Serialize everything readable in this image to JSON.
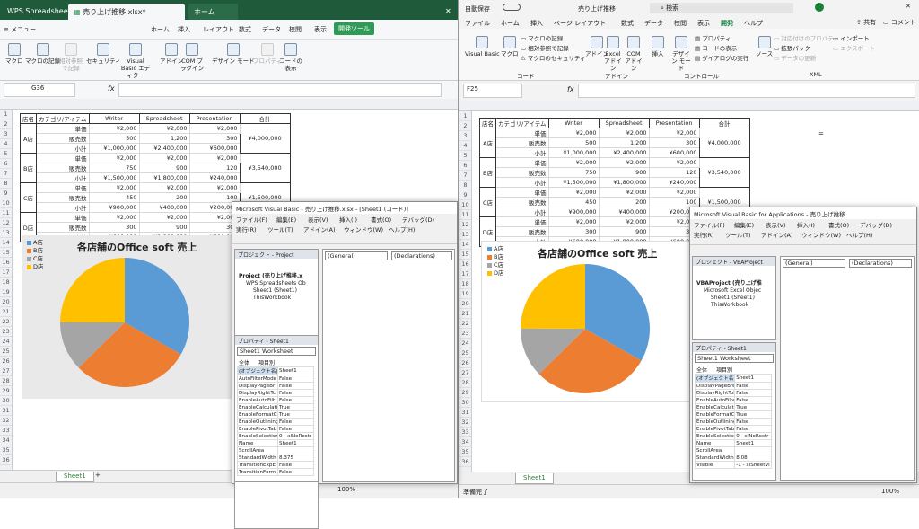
{
  "wps": {
    "tabs": [
      "WPS Spreadsheets",
      "売り上げ推移.xlsx*",
      "ホーム"
    ],
    "menu": [
      "≡ メニュー",
      "ホーム",
      "挿入",
      "レイアウト",
      "数式",
      "データ",
      "校閲",
      "表示",
      "開発ツール"
    ],
    "ribbon": [
      "マクロ",
      "マクロの記録",
      "相対参照で記録",
      "セキュリティ",
      "Visual Basic エディター",
      "アドイン",
      "COM プラグイン",
      "デザイン モード",
      "プロパティ",
      "コードの表示"
    ],
    "cellref": "G36",
    "fx": "fx",
    "cols": [
      "A",
      "B",
      "C",
      "D",
      "E",
      "F",
      "G",
      "H",
      "I"
    ],
    "sheet_tab": "Sheet1",
    "zoom": "100%"
  },
  "table": {
    "header": [
      "店名",
      "カテゴリ/アイテム",
      "Writer",
      "Spreadsheet",
      "Presentation",
      "合計"
    ],
    "stores": [
      {
        "name": "A店",
        "rows": [
          [
            "単価",
            "¥2,000",
            "¥2,000",
            "¥2,000"
          ],
          [
            "販売数",
            "500",
            "1,200",
            "300"
          ],
          [
            "小計",
            "¥1,000,000",
            "¥2,400,000",
            "¥600,000"
          ]
        ],
        "total": "¥4,000,000"
      },
      {
        "name": "B店",
        "rows": [
          [
            "単価",
            "¥2,000",
            "¥2,000",
            "¥2,000"
          ],
          [
            "販売数",
            "750",
            "900",
            "120"
          ],
          [
            "小計",
            "¥1,500,000",
            "¥1,800,000",
            "¥240,000"
          ]
        ],
        "total": "¥3,540,000"
      },
      {
        "name": "C店",
        "rows": [
          [
            "単価",
            "¥2,000",
            "¥2,000",
            "¥2,000"
          ],
          [
            "販売数",
            "450",
            "200",
            "100"
          ],
          [
            "小計",
            "¥900,000",
            "¥400,000",
            "¥200,000"
          ]
        ],
        "total": "¥1,500,000"
      },
      {
        "name": "D店",
        "rows": [
          [
            "単価",
            "¥2,000",
            "¥2,000",
            "¥2,000"
          ],
          [
            "販売数",
            "300",
            "900",
            "300"
          ],
          [
            "小計",
            "¥600,000",
            "¥1,800,000",
            "¥600,000"
          ]
        ],
        "total": ""
      }
    ]
  },
  "chart_data": {
    "type": "pie",
    "title": "各店舗のOffice soft 売上",
    "categories": [
      "A店",
      "B店",
      "C店",
      "D店"
    ],
    "values": [
      4000000,
      3540000,
      1500000,
      3000000
    ],
    "colors": [
      "#5b9bd5",
      "#ed7d31",
      "#a5a5a5",
      "#ffc000"
    ],
    "legend": "top-left"
  },
  "excel": {
    "autosave": "自動保存",
    "filename": "売り上げ推移",
    "search": "検索",
    "tabs": [
      "ファイル",
      "ホーム",
      "挿入",
      "ページ レイアウト",
      "数式",
      "データ",
      "校閲",
      "表示",
      "開発",
      "ヘルプ"
    ],
    "share": "共有",
    "comment": "コメント",
    "ribbon": [
      "Visual Basic",
      "マクロ",
      "マクロの記録",
      "相対参照で記録",
      "マクロのセキュリティ",
      "アドイン",
      "Excel アドイン",
      "COM アドイン",
      "挿入",
      "デザイン モード",
      "プロパティ",
      "コードの表示",
      "ダイアログの実行",
      "ソース",
      "対応付けのプロパティ",
      "拡張パック",
      "データの更新",
      "インポート",
      "エクスポート"
    ],
    "groups": [
      "コード",
      "アドイン",
      "コントロール",
      "XML"
    ],
    "cellref": "F25",
    "fx": "fx",
    "cols": [
      "B",
      "C",
      "D",
      "E",
      "F",
      "G",
      "H",
      "I",
      "J"
    ],
    "sheet_tab": "Sheet1",
    "status": "準備完了",
    "zoom": "100%"
  },
  "vbe1": {
    "title": "Microsoft Visual Basic - 売り上げ推移.xlsx - [Sheet1 (コード)]",
    "menu": [
      "ファイル(F)",
      "編集(E)",
      "表示(V)",
      "挿入(I)",
      "書式(O)",
      "デバッグ(D)",
      "実行(R)",
      "ツール(T)",
      "アドイン(A)",
      "ウィンドウ(W)",
      "ヘルプ(H)"
    ],
    "project_title": "プロジェクト - Project",
    "tree": [
      "Project (売り上げ推移.x",
      "WPS Spreadsheets Ob",
      "Sheet1 (Sheet1)",
      "ThisWorkbook"
    ],
    "props_title": "プロパティ - Sheet1",
    "props_obj": "Sheet1 Worksheet",
    "props_tabs": [
      "全体",
      "項目別"
    ],
    "props": [
      [
        "(オブジェクト名)",
        "Sheet1"
      ],
      [
        "AutoFilterMode",
        "False"
      ],
      [
        "DisplayPageBr",
        "False"
      ],
      [
        "DisplayRightTc",
        "False"
      ],
      [
        "EnableAutoFilt",
        "False"
      ],
      [
        "EnableCalculati",
        "True"
      ],
      [
        "EnableFormatCc",
        "True"
      ],
      [
        "EnableOutlining",
        "False"
      ],
      [
        "EnablePivotTab",
        "False"
      ],
      [
        "EnableSelection",
        "0 - xlNoRestr"
      ],
      [
        "Name",
        "Sheet1"
      ],
      [
        "ScrollArea",
        ""
      ],
      [
        "StandardWidth",
        "8.375"
      ],
      [
        "TransitionExpE",
        "False"
      ],
      [
        "TransitionForm",
        "False"
      ]
    ],
    "general": "(General)",
    "decl": "(Declarations)"
  },
  "vbe2": {
    "title": "Microsoft Visual Basic for Applications - 売り上げ推移",
    "menu": [
      "ファイル(F)",
      "編集(E)",
      "表示(V)",
      "挿入(I)",
      "書式(O)",
      "デバッグ(D)",
      "実行(R)",
      "ツール(T)",
      "アドイン(A)",
      "ウィンドウ(W)",
      "ヘルプ(H)"
    ],
    "project_title": "プロジェクト - VBAProject",
    "tree": [
      "VBAProject (売り上げ推",
      "Microsoft Excel Objec",
      "Sheet1 (Sheet1)",
      "ThisWorkbook"
    ],
    "props_title": "プロパティ - Sheet1",
    "props_obj": "Sheet1 Worksheet",
    "props_tabs": [
      "全体",
      "項目別"
    ],
    "props": [
      [
        "(オブジェクト名)",
        "Sheet1"
      ],
      [
        "DisplayPageBrea",
        "False"
      ],
      [
        "DisplayRightToLe",
        "False"
      ],
      [
        "EnableAutoFilter",
        "False"
      ],
      [
        "EnableCalculation",
        "True"
      ],
      [
        "EnableFormatCon",
        "True"
      ],
      [
        "EnableOutlining",
        "False"
      ],
      [
        "EnablePivotTable",
        "False"
      ],
      [
        "EnableSelection",
        "0 - xlNoRestr"
      ],
      [
        "Name",
        "Sheet1"
      ],
      [
        "ScrollArea",
        ""
      ],
      [
        "StandardWidth",
        "8.08"
      ],
      [
        "Visible",
        "-1 - xlSheetVi"
      ]
    ],
    "general": "(General)",
    "decl": "(Declarations)"
  }
}
